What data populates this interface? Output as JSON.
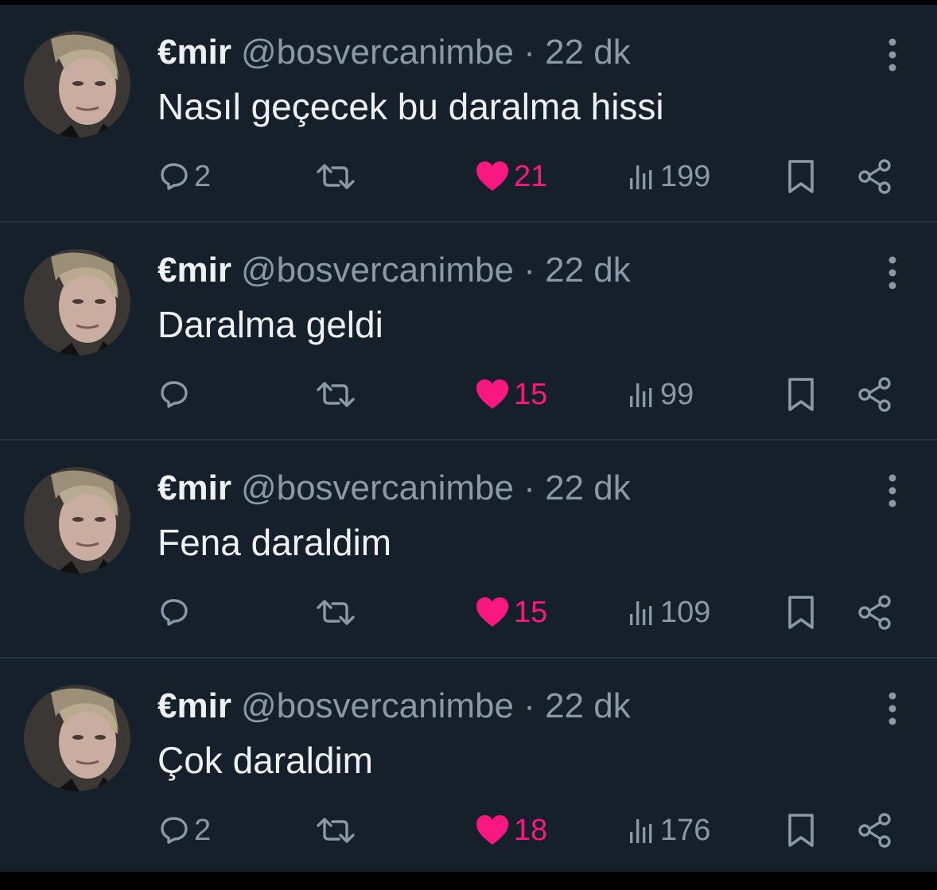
{
  "tweets": [
    {
      "name": "€mir",
      "handle": "@bosvercanimbe",
      "separator": "·",
      "time": "22 dk",
      "text": "Nasıl geçecek bu daralma hissi",
      "replies": "2",
      "likes": "21",
      "views": "199"
    },
    {
      "name": "€mir",
      "handle": "@bosvercanimbe",
      "separator": "·",
      "time": "22 dk",
      "text": "Daralma geldi",
      "replies": "",
      "likes": "15",
      "views": "99"
    },
    {
      "name": "€mir",
      "handle": "@bosvercanimbe",
      "separator": "·",
      "time": "22 dk",
      "text": "Fena daraldim",
      "replies": "",
      "likes": "15",
      "views": "109"
    },
    {
      "name": "€mir",
      "handle": "@bosvercanimbe",
      "separator": "·",
      "time": "22 dk",
      "text": "Çok daraldim",
      "replies": "2",
      "likes": "18",
      "views": "176"
    }
  ],
  "colors": {
    "background": "#15202b",
    "text": "#eef1f3",
    "muted": "#8b98a5",
    "like": "#f91880",
    "divider": "#243343"
  },
  "icons": {
    "reply": "speech-bubble-icon",
    "retweet": "retweet-arrows-icon",
    "like": "heart-filled-icon",
    "views": "bar-chart-icon",
    "bookmark": "bookmark-icon",
    "share": "share-nodes-icon",
    "more": "vertical-dots-icon"
  }
}
